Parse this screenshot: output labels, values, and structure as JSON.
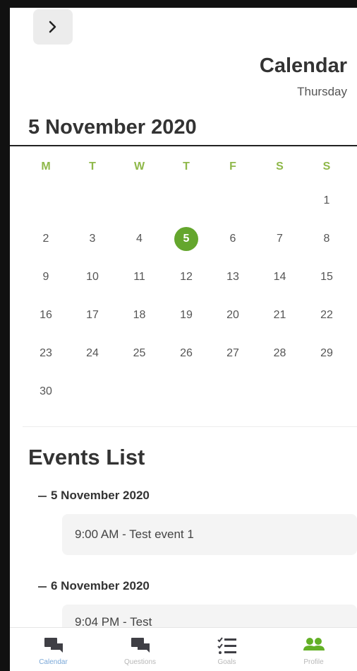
{
  "header": {
    "back_icon": "chevron-right-icon",
    "title": "Calendar",
    "subtitle": "Thursday",
    "selected_date": "5 November 2020"
  },
  "calendar": {
    "weekdays": [
      "M",
      "T",
      "W",
      "T",
      "F",
      "S",
      "S"
    ],
    "weeks": [
      [
        "",
        "",
        "",
        "",
        "",
        "",
        "1"
      ],
      [
        "2",
        "3",
        "4",
        "5",
        "6",
        "7",
        "8"
      ],
      [
        "9",
        "10",
        "11",
        "12",
        "13",
        "14",
        "15"
      ],
      [
        "16",
        "17",
        "18",
        "19",
        "20",
        "21",
        "22"
      ],
      [
        "23",
        "24",
        "25",
        "26",
        "27",
        "28",
        "29"
      ],
      [
        "30",
        "",
        "",
        "",
        "",
        "",
        ""
      ]
    ],
    "selected_day": "5",
    "accent_color": "#64a62d"
  },
  "events": {
    "title": "Events List",
    "groups": [
      {
        "date": "5 November 2020",
        "items": [
          "9:00 AM - Test event 1"
        ]
      },
      {
        "date": "6 November 2020",
        "items": [
          "9:04 PM - Test"
        ]
      }
    ]
  },
  "nav": {
    "items": [
      {
        "label": "Calendar",
        "icon": "chat-bubbles-icon",
        "active": true
      },
      {
        "label": "Questions",
        "icon": "chat-bubbles-icon",
        "active": false
      },
      {
        "label": "Goals",
        "icon": "checklist-icon",
        "active": false
      },
      {
        "label": "Profile",
        "icon": "people-icon",
        "active": false
      }
    ]
  }
}
